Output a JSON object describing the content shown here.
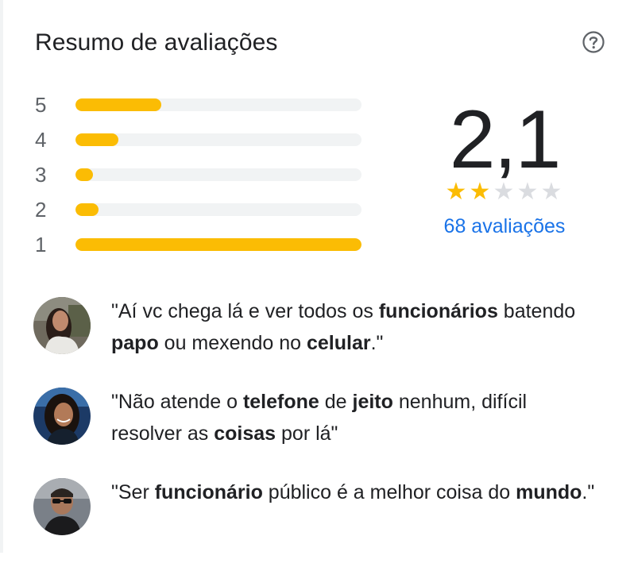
{
  "header": {
    "title": "Resumo de avaliações",
    "help_icon": "help-circle-icon"
  },
  "rating_distribution": [
    {
      "label": "5",
      "fraction": 0.3
    },
    {
      "label": "4",
      "fraction": 0.15
    },
    {
      "label": "3",
      "fraction": 0.06
    },
    {
      "label": "2",
      "fraction": 0.08
    },
    {
      "label": "1",
      "fraction": 1.0
    }
  ],
  "summary": {
    "score": "2,1",
    "stars_filled": 2,
    "stars_total": 5,
    "review_count": "68 avaliações"
  },
  "reviews": [
    {
      "segments": [
        {
          "text": "\"Aí vc chega lá e ver todos os ",
          "bold": false
        },
        {
          "text": "funcionários",
          "bold": true
        },
        {
          "text": " batendo ",
          "bold": false
        },
        {
          "text": "papo",
          "bold": true
        },
        {
          "text": " ou mexendo no ",
          "bold": false
        },
        {
          "text": "celular",
          "bold": true
        },
        {
          "text": ".\"",
          "bold": false
        }
      ]
    },
    {
      "segments": [
        {
          "text": "\"Não atende o ",
          "bold": false
        },
        {
          "text": "telefone",
          "bold": true
        },
        {
          "text": " de ",
          "bold": false
        },
        {
          "text": "jeito",
          "bold": true
        },
        {
          "text": " nenhum, difícil resolver as ",
          "bold": false
        },
        {
          "text": "coisas",
          "bold": true
        },
        {
          "text": " por lá\"",
          "bold": false
        }
      ]
    },
    {
      "segments": [
        {
          "text": "\"Ser ",
          "bold": false
        },
        {
          "text": "funcionário",
          "bold": true
        },
        {
          "text": " público é a melhor coisa do ",
          "bold": false
        },
        {
          "text": "mundo",
          "bold": true
        },
        {
          "text": ".\"",
          "bold": false
        }
      ]
    }
  ],
  "colors": {
    "bar_fill": "#fbbc04",
    "bar_track": "#f1f3f4",
    "star_filled": "#fbbc04",
    "star_empty": "#dadce0",
    "link": "#1a73e8"
  }
}
